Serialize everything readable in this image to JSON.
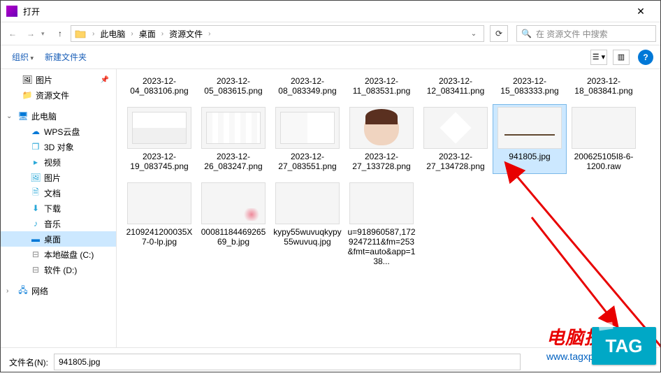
{
  "window": {
    "title": "打开",
    "close": "✕"
  },
  "nav": {
    "crumbs": [
      "此电脑",
      "桌面",
      "资源文件"
    ],
    "search_placeholder": "在 资源文件 中搜索"
  },
  "toolbar": {
    "organize": "组织",
    "new_folder": "新建文件夹"
  },
  "sidebar": {
    "quick": [
      {
        "icon": "🖼",
        "label": "图片",
        "pinned": true
      },
      {
        "icon": "📁",
        "label": "资源文件"
      }
    ],
    "thispc_label": "此电脑",
    "thispc": [
      {
        "icon": "☁",
        "color": "#0078d7",
        "label": "WPS云盘"
      },
      {
        "icon": "❒",
        "color": "#2aa8d8",
        "label": "3D 对象"
      },
      {
        "icon": "▸",
        "color": "#2aa8d8",
        "label": "视频"
      },
      {
        "icon": "🖼",
        "color": "#2aa8d8",
        "label": "图片"
      },
      {
        "icon": "🗎",
        "color": "#2aa8d8",
        "label": "文档"
      },
      {
        "icon": "⬇",
        "color": "#2aa8d8",
        "label": "下载"
      },
      {
        "icon": "♪",
        "color": "#2aa8d8",
        "label": "音乐"
      },
      {
        "icon": "▬",
        "color": "#0078d7",
        "label": "桌面",
        "selected": true
      },
      {
        "icon": "⊟",
        "color": "#888",
        "label": "本地磁盘 (C:)"
      },
      {
        "icon": "⊟",
        "color": "#888",
        "label": "软件 (D:)"
      }
    ],
    "network_label": "网络"
  },
  "files_row1": [
    {
      "name": "2023-12-04_083106.png"
    },
    {
      "name": "2023-12-05_083615.png"
    },
    {
      "name": "2023-12-08_083349.png"
    },
    {
      "name": "2023-12-11_083531.png"
    },
    {
      "name": "2023-12-12_083411.png"
    },
    {
      "name": "2023-12-15_083333.png"
    },
    {
      "name": "2023-12-18_083841.png"
    }
  ],
  "files_row2": [
    {
      "name": "2023-12-19_083745.png",
      "th": "th-spread1"
    },
    {
      "name": "2023-12-26_083247.png",
      "th": "th-spread2"
    },
    {
      "name": "2023-12-27_083551.png",
      "th": "th-spread3"
    },
    {
      "name": "2023-12-27_133728.png",
      "th": "th-face"
    },
    {
      "name": "2023-12-27_134728.png",
      "th": "th-diamond"
    },
    {
      "name": "941805.jpg",
      "th": "th-landscape",
      "selected": true
    },
    {
      "name": "200625105I8-6-1200.raw",
      "th": "th-leaves"
    }
  ],
  "files_row3": [
    {
      "name": "2109241200035X7-0-lp.jpg",
      "th": "th-sunset"
    },
    {
      "name": "0008118446926569_b.jpg",
      "th": "th-floral"
    },
    {
      "name": "kypy55wuvuqkypy55wuvuq.jpg",
      "th": "th-dark"
    },
    {
      "name": "u=918960587,1729247211&fm=253&fmt=auto&app=138...",
      "th": "th-sunrise"
    }
  ],
  "bottom": {
    "label": "文件名(N):",
    "value": "941805.jpg"
  },
  "watermark": {
    "line1": "电脑技术网",
    "line2": "www.tagxp.com",
    "tag": "TAG"
  }
}
